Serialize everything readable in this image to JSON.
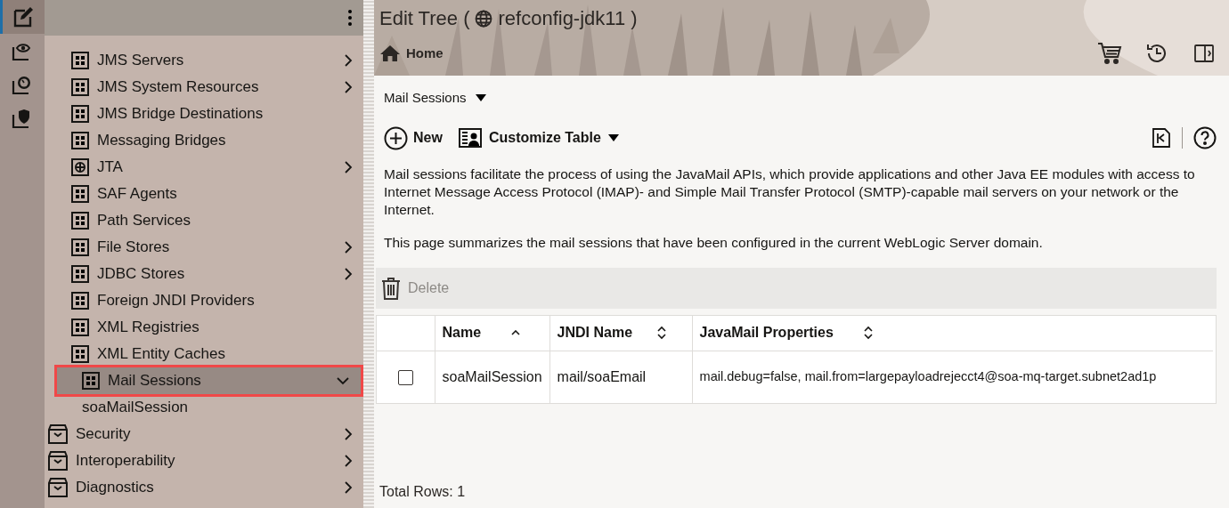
{
  "rail": [
    {
      "kind": "edit",
      "selected": true
    },
    {
      "kind": "view",
      "selected": false
    },
    {
      "kind": "monitor",
      "selected": false
    },
    {
      "kind": "security",
      "selected": false
    }
  ],
  "nav": {
    "inner_items": [
      {
        "label": "JMS Servers",
        "kind": "grid",
        "expandable": true,
        "expanded": false,
        "selected": false
      },
      {
        "label": "JMS System Resources",
        "kind": "grid",
        "expandable": true,
        "expanded": false,
        "selected": false
      },
      {
        "label": "JMS Bridge Destinations",
        "kind": "grid",
        "expandable": false,
        "selected": false
      },
      {
        "label": "Messaging Bridges",
        "kind": "grid",
        "expandable": false,
        "selected": false
      },
      {
        "label": "JTA",
        "kind": "target",
        "expandable": true,
        "expanded": false,
        "selected": false
      },
      {
        "label": "SAF Agents",
        "kind": "grid",
        "expandable": false,
        "selected": false
      },
      {
        "label": "Path Services",
        "kind": "grid",
        "expandable": false,
        "selected": false
      },
      {
        "label": "File Stores",
        "kind": "grid",
        "expandable": true,
        "expanded": false,
        "selected": false
      },
      {
        "label": "JDBC Stores",
        "kind": "grid",
        "expandable": true,
        "expanded": false,
        "selected": false
      },
      {
        "label": "Foreign JNDI Providers",
        "kind": "grid",
        "expandable": false,
        "selected": false
      },
      {
        "label": "XML Registries",
        "kind": "grid",
        "expandable": false,
        "selected": false
      },
      {
        "label": "XML Entity Caches",
        "kind": "grid",
        "expandable": false,
        "selected": false
      },
      {
        "label": "Mail Sessions",
        "kind": "grid",
        "expandable": true,
        "expanded": true,
        "selected": true,
        "outlined": true,
        "children": [
          {
            "label": "soaMailSession"
          }
        ]
      }
    ],
    "items": [
      {
        "label": "Security",
        "kind": "box",
        "expandable": true,
        "expanded": false,
        "selected": false
      },
      {
        "label": "Interoperability",
        "kind": "box",
        "expandable": true,
        "expanded": false,
        "selected": false
      },
      {
        "label": "Diagnostics",
        "kind": "box",
        "expandable": true,
        "expanded": false,
        "selected": false
      }
    ]
  },
  "header": {
    "title_prefix": "Edit Tree (",
    "title_name": "refconfig-jdk11 )",
    "breadcrumb": "Home"
  },
  "page_menu": "Mail Sessions",
  "actions": {
    "new": "New",
    "customize": "Customize Table"
  },
  "description": [
    "Mail sessions facilitate the process of using the JavaMail APIs, which provide applications and other Java EE modules with access to Internet Message Access Protocol (IMAP)- and Simple Mail Transfer Protocol (SMTP)-capable mail servers on your network or the Internet.",
    "This page summarizes the mail sessions that have been configured in the current WebLogic Server domain."
  ],
  "toolbar": {
    "delete": "Delete",
    "delete_disabled": true
  },
  "table": {
    "columns": [
      {
        "label": "Name",
        "sorted": true
      },
      {
        "label": "JNDI Name",
        "sorted": false
      },
      {
        "label": "JavaMail Properties",
        "sorted": false
      }
    ],
    "rows": [
      {
        "checked": false,
        "cells": [
          "soaMailSession",
          "mail/soaEmail",
          "mail.debug=false, mail.from=largepayloadrejecct4@soa-mq-target.subnet2ad1p"
        ]
      }
    ]
  },
  "status": "Total Rows: 1"
}
